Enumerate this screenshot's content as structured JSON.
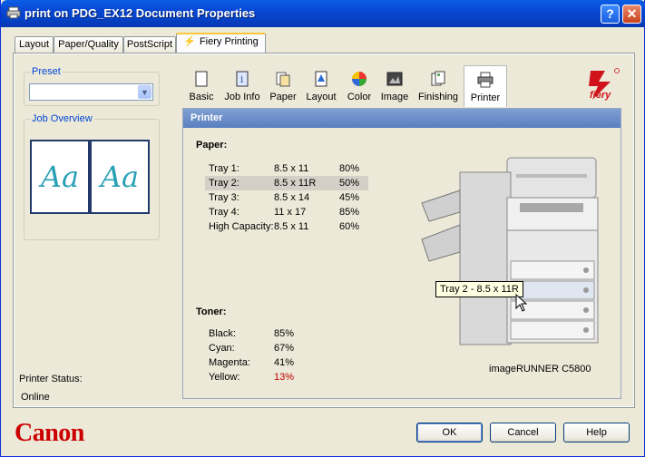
{
  "window": {
    "title": "print on PDG_EX12 Document Properties",
    "help": "?",
    "close": "✕"
  },
  "tabs": [
    "Layout",
    "Paper/Quality",
    "PostScript",
    "Fiery Printing"
  ],
  "preset": {
    "label": "Preset",
    "value": ""
  },
  "job_overview": {
    "label": "Job Overview",
    "glyph": "Aa"
  },
  "fiery_nav": [
    "Basic",
    "Job Info",
    "Paper",
    "Layout",
    "Color",
    "Image",
    "Finishing",
    "Printer"
  ],
  "panel": {
    "title": "Printer"
  },
  "paper": {
    "title": "Paper:",
    "rows": [
      {
        "tray": "Tray 1:",
        "size": "8.5 x 11",
        "level": "80%"
      },
      {
        "tray": "Tray 2:",
        "size": "8.5 x 11R",
        "level": "50%"
      },
      {
        "tray": "Tray 3:",
        "size": "8.5 x 14",
        "level": "45%"
      },
      {
        "tray": "Tray 4:",
        "size": "11 x 17",
        "level": "85%"
      },
      {
        "tray": "High Capacity:",
        "size": "8.5 x 11",
        "level": "60%"
      }
    ]
  },
  "toner": {
    "title": "Toner:",
    "rows": [
      {
        "color": "Black:",
        "level": "85%"
      },
      {
        "color": "Cyan:",
        "level": "67%"
      },
      {
        "color": "Magenta:",
        "level": "41%"
      },
      {
        "color": "Yellow:",
        "level": "13%"
      }
    ],
    "low_color": "#c00000"
  },
  "tooltip": "Tray 2 - 8.5 x 11R",
  "model": "imageRUNNER C5800",
  "status": {
    "label": "Printer Status:",
    "value": "Online"
  },
  "brand": "Canon",
  "fiery_brand": "fiery",
  "buttons": {
    "ok": "OK",
    "cancel": "Cancel",
    "help": "Help"
  }
}
